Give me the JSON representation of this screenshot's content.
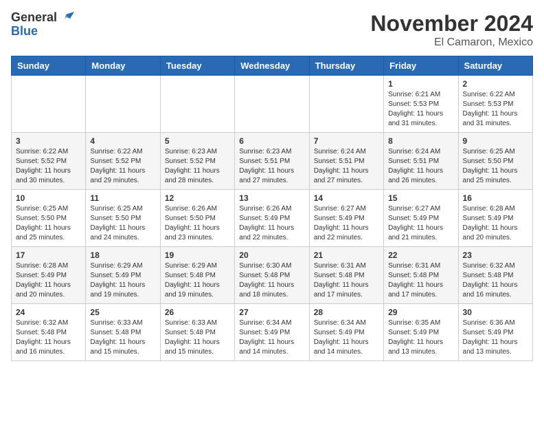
{
  "logo": {
    "text_general": "General",
    "text_blue": "Blue"
  },
  "title": {
    "month": "November 2024",
    "location": "El Camaron, Mexico"
  },
  "headers": [
    "Sunday",
    "Monday",
    "Tuesday",
    "Wednesday",
    "Thursday",
    "Friday",
    "Saturday"
  ],
  "weeks": [
    [
      {
        "day": "",
        "info": ""
      },
      {
        "day": "",
        "info": ""
      },
      {
        "day": "",
        "info": ""
      },
      {
        "day": "",
        "info": ""
      },
      {
        "day": "",
        "info": ""
      },
      {
        "day": "1",
        "info": "Sunrise: 6:21 AM\nSunset: 5:53 PM\nDaylight: 11 hours and 31 minutes."
      },
      {
        "day": "2",
        "info": "Sunrise: 6:22 AM\nSunset: 5:53 PM\nDaylight: 11 hours and 31 minutes."
      }
    ],
    [
      {
        "day": "3",
        "info": "Sunrise: 6:22 AM\nSunset: 5:52 PM\nDaylight: 11 hours and 30 minutes."
      },
      {
        "day": "4",
        "info": "Sunrise: 6:22 AM\nSunset: 5:52 PM\nDaylight: 11 hours and 29 minutes."
      },
      {
        "day": "5",
        "info": "Sunrise: 6:23 AM\nSunset: 5:52 PM\nDaylight: 11 hours and 28 minutes."
      },
      {
        "day": "6",
        "info": "Sunrise: 6:23 AM\nSunset: 5:51 PM\nDaylight: 11 hours and 27 minutes."
      },
      {
        "day": "7",
        "info": "Sunrise: 6:24 AM\nSunset: 5:51 PM\nDaylight: 11 hours and 27 minutes."
      },
      {
        "day": "8",
        "info": "Sunrise: 6:24 AM\nSunset: 5:51 PM\nDaylight: 11 hours and 26 minutes."
      },
      {
        "day": "9",
        "info": "Sunrise: 6:25 AM\nSunset: 5:50 PM\nDaylight: 11 hours and 25 minutes."
      }
    ],
    [
      {
        "day": "10",
        "info": "Sunrise: 6:25 AM\nSunset: 5:50 PM\nDaylight: 11 hours and 25 minutes."
      },
      {
        "day": "11",
        "info": "Sunrise: 6:25 AM\nSunset: 5:50 PM\nDaylight: 11 hours and 24 minutes."
      },
      {
        "day": "12",
        "info": "Sunrise: 6:26 AM\nSunset: 5:50 PM\nDaylight: 11 hours and 23 minutes."
      },
      {
        "day": "13",
        "info": "Sunrise: 6:26 AM\nSunset: 5:49 PM\nDaylight: 11 hours and 22 minutes."
      },
      {
        "day": "14",
        "info": "Sunrise: 6:27 AM\nSunset: 5:49 PM\nDaylight: 11 hours and 22 minutes."
      },
      {
        "day": "15",
        "info": "Sunrise: 6:27 AM\nSunset: 5:49 PM\nDaylight: 11 hours and 21 minutes."
      },
      {
        "day": "16",
        "info": "Sunrise: 6:28 AM\nSunset: 5:49 PM\nDaylight: 11 hours and 20 minutes."
      }
    ],
    [
      {
        "day": "17",
        "info": "Sunrise: 6:28 AM\nSunset: 5:49 PM\nDaylight: 11 hours and 20 minutes."
      },
      {
        "day": "18",
        "info": "Sunrise: 6:29 AM\nSunset: 5:49 PM\nDaylight: 11 hours and 19 minutes."
      },
      {
        "day": "19",
        "info": "Sunrise: 6:29 AM\nSunset: 5:48 PM\nDaylight: 11 hours and 19 minutes."
      },
      {
        "day": "20",
        "info": "Sunrise: 6:30 AM\nSunset: 5:48 PM\nDaylight: 11 hours and 18 minutes."
      },
      {
        "day": "21",
        "info": "Sunrise: 6:31 AM\nSunset: 5:48 PM\nDaylight: 11 hours and 17 minutes."
      },
      {
        "day": "22",
        "info": "Sunrise: 6:31 AM\nSunset: 5:48 PM\nDaylight: 11 hours and 17 minutes."
      },
      {
        "day": "23",
        "info": "Sunrise: 6:32 AM\nSunset: 5:48 PM\nDaylight: 11 hours and 16 minutes."
      }
    ],
    [
      {
        "day": "24",
        "info": "Sunrise: 6:32 AM\nSunset: 5:48 PM\nDaylight: 11 hours and 16 minutes."
      },
      {
        "day": "25",
        "info": "Sunrise: 6:33 AM\nSunset: 5:48 PM\nDaylight: 11 hours and 15 minutes."
      },
      {
        "day": "26",
        "info": "Sunrise: 6:33 AM\nSunset: 5:48 PM\nDaylight: 11 hours and 15 minutes."
      },
      {
        "day": "27",
        "info": "Sunrise: 6:34 AM\nSunset: 5:49 PM\nDaylight: 11 hours and 14 minutes."
      },
      {
        "day": "28",
        "info": "Sunrise: 6:34 AM\nSunset: 5:49 PM\nDaylight: 11 hours and 14 minutes."
      },
      {
        "day": "29",
        "info": "Sunrise: 6:35 AM\nSunset: 5:49 PM\nDaylight: 11 hours and 13 minutes."
      },
      {
        "day": "30",
        "info": "Sunrise: 6:36 AM\nSunset: 5:49 PM\nDaylight: 11 hours and 13 minutes."
      }
    ]
  ]
}
